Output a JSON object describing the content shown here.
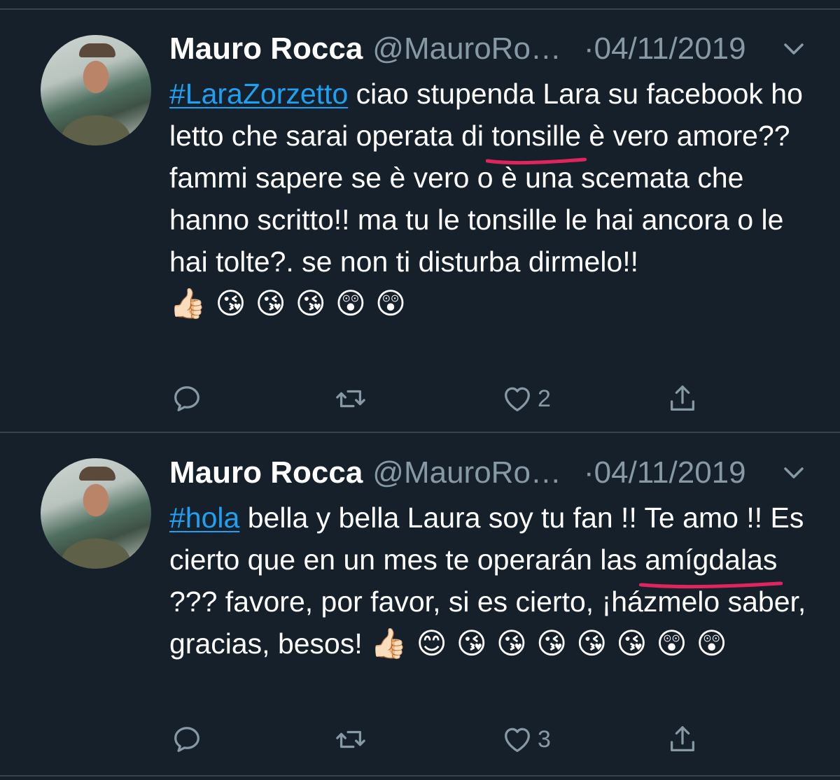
{
  "colors": {
    "background": "#15202b",
    "divider": "#38444d",
    "muted": "#8899a6",
    "link": "#1da1f2",
    "underline_mark": "#e0245e"
  },
  "tweets": [
    {
      "author": {
        "name": "Mauro Rocca",
        "handle": "@MauroRo…"
      },
      "dot": "·",
      "date": "04/11/2019",
      "caret_icon": "chevron-down-icon",
      "text": {
        "hashtag": "#LaraZorzetto",
        "part1": " ciao stupenda Lara su facebook ho letto che sarai operata di ",
        "marked": "tonsille",
        "part2": " è vero amore?? fammi sapere se è vero o è una scemata che hanno scritto!! ma tu le tonsille le hai ancora o le hai tolte?. se non ti disturba dirmelo!! ",
        "emoji": "👍🏻 😘 😘 😘 😲 😲"
      },
      "actions": {
        "reply_icon": "reply-icon",
        "retweet_icon": "retweet-icon",
        "like_icon": "heart-icon",
        "like_count": "2",
        "share_icon": "share-icon"
      }
    },
    {
      "author": {
        "name": "Mauro Rocca",
        "handle": "@MauroRo…"
      },
      "dot": "·",
      "date": "04/11/2019",
      "caret_icon": "chevron-down-icon",
      "text": {
        "hashtag": "#hola",
        "part1": " bella y bella Laura soy tu fan !!  Te amo !!  Es cierto que en un mes te operarán las ",
        "marked": "amígdalas",
        "part2": " ??? favore, por favor, si es cierto, ¡házmelo saber, gracias, besos! ",
        "emoji": "👍🏻 😊 😘 😘 😘 😘 😘 😲 😲"
      },
      "actions": {
        "reply_icon": "reply-icon",
        "retweet_icon": "retweet-icon",
        "like_icon": "heart-icon",
        "like_count": "3",
        "share_icon": "share-icon"
      }
    }
  ]
}
